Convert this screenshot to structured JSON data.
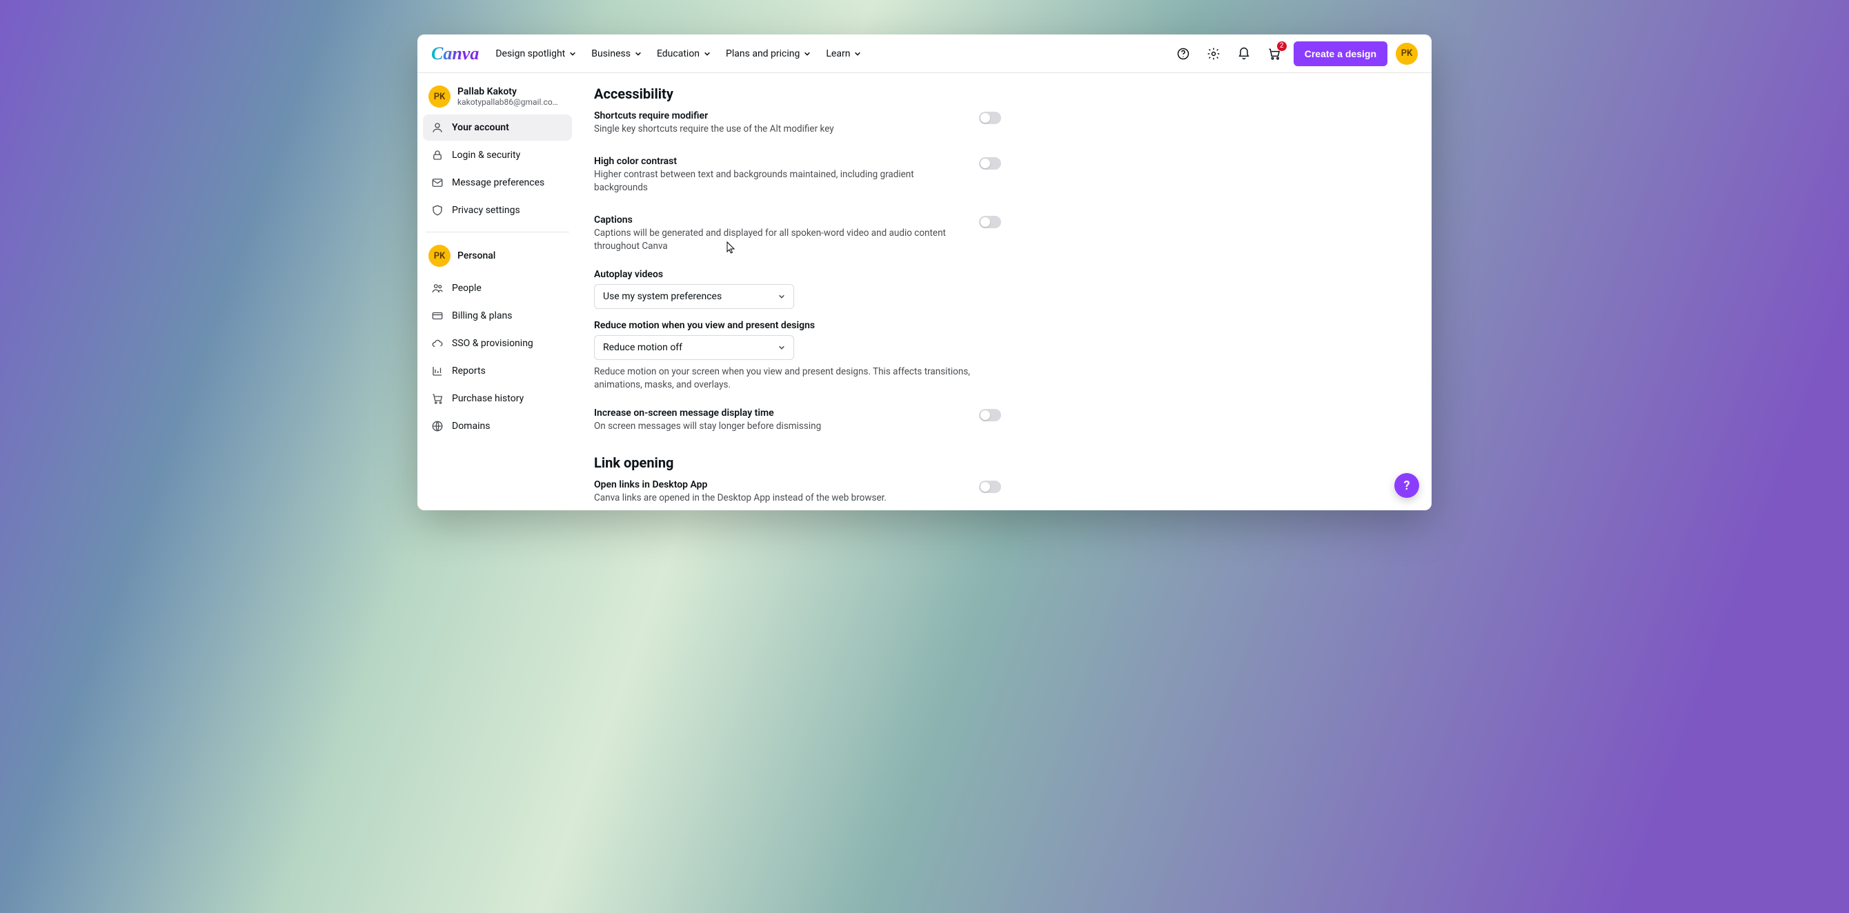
{
  "header": {
    "logo_text": "Canva",
    "nav": [
      {
        "label": "Design spotlight"
      },
      {
        "label": "Business"
      },
      {
        "label": "Education"
      },
      {
        "label": "Plans and pricing"
      },
      {
        "label": "Learn"
      }
    ],
    "cart_badge": "2",
    "cta_label": "Create a design",
    "avatar_initials": "PK"
  },
  "sidebar": {
    "profile": {
      "initials": "PK",
      "name": "Pallab Kakoty",
      "email": "kakotypallab86@gmail.co…"
    },
    "group1": [
      {
        "label": "Your account",
        "active": true,
        "slug": "your-account"
      },
      {
        "label": "Login & security",
        "active": false,
        "slug": "login-security"
      },
      {
        "label": "Message preferences",
        "active": false,
        "slug": "message-preferences"
      },
      {
        "label": "Privacy settings",
        "active": false,
        "slug": "privacy-settings"
      }
    ],
    "workspace": {
      "initials": "PK",
      "name": "Personal"
    },
    "group2": [
      {
        "label": "People",
        "slug": "people"
      },
      {
        "label": "Billing & plans",
        "slug": "billing-plans"
      },
      {
        "label": "SSO & provisioning",
        "slug": "sso-provisioning"
      },
      {
        "label": "Reports",
        "slug": "reports"
      },
      {
        "label": "Purchase history",
        "slug": "purchase-history"
      },
      {
        "label": "Domains",
        "slug": "domains"
      }
    ]
  },
  "main": {
    "section1_title": "Accessibility",
    "shortcuts": {
      "label": "Shortcuts require modifier",
      "desc": "Single key shortcuts require the use of the Alt modifier key"
    },
    "contrast": {
      "label": "High color contrast",
      "desc": "Higher contrast between text and backgrounds maintained, including gradient backgrounds"
    },
    "captions": {
      "label": "Captions",
      "desc": "Captions will be generated and displayed for all spoken-word video and audio content throughout Canva"
    },
    "autoplay": {
      "label": "Autoplay videos",
      "selected": "Use my system preferences"
    },
    "reduce_motion": {
      "label": "Reduce motion when you view and present designs",
      "selected": "Reduce motion off",
      "desc": "Reduce motion on your screen when you view and present designs. This affects transitions, animations, masks, and overlays."
    },
    "display_time": {
      "label": "Increase on-screen message display time",
      "desc": "On screen messages will stay longer before dismissing"
    },
    "section2_title": "Link opening",
    "open_links": {
      "label": "Open links in Desktop App",
      "desc": "Canva links are opened in the Desktop App instead of the web browser."
    }
  },
  "help_fab": "?"
}
